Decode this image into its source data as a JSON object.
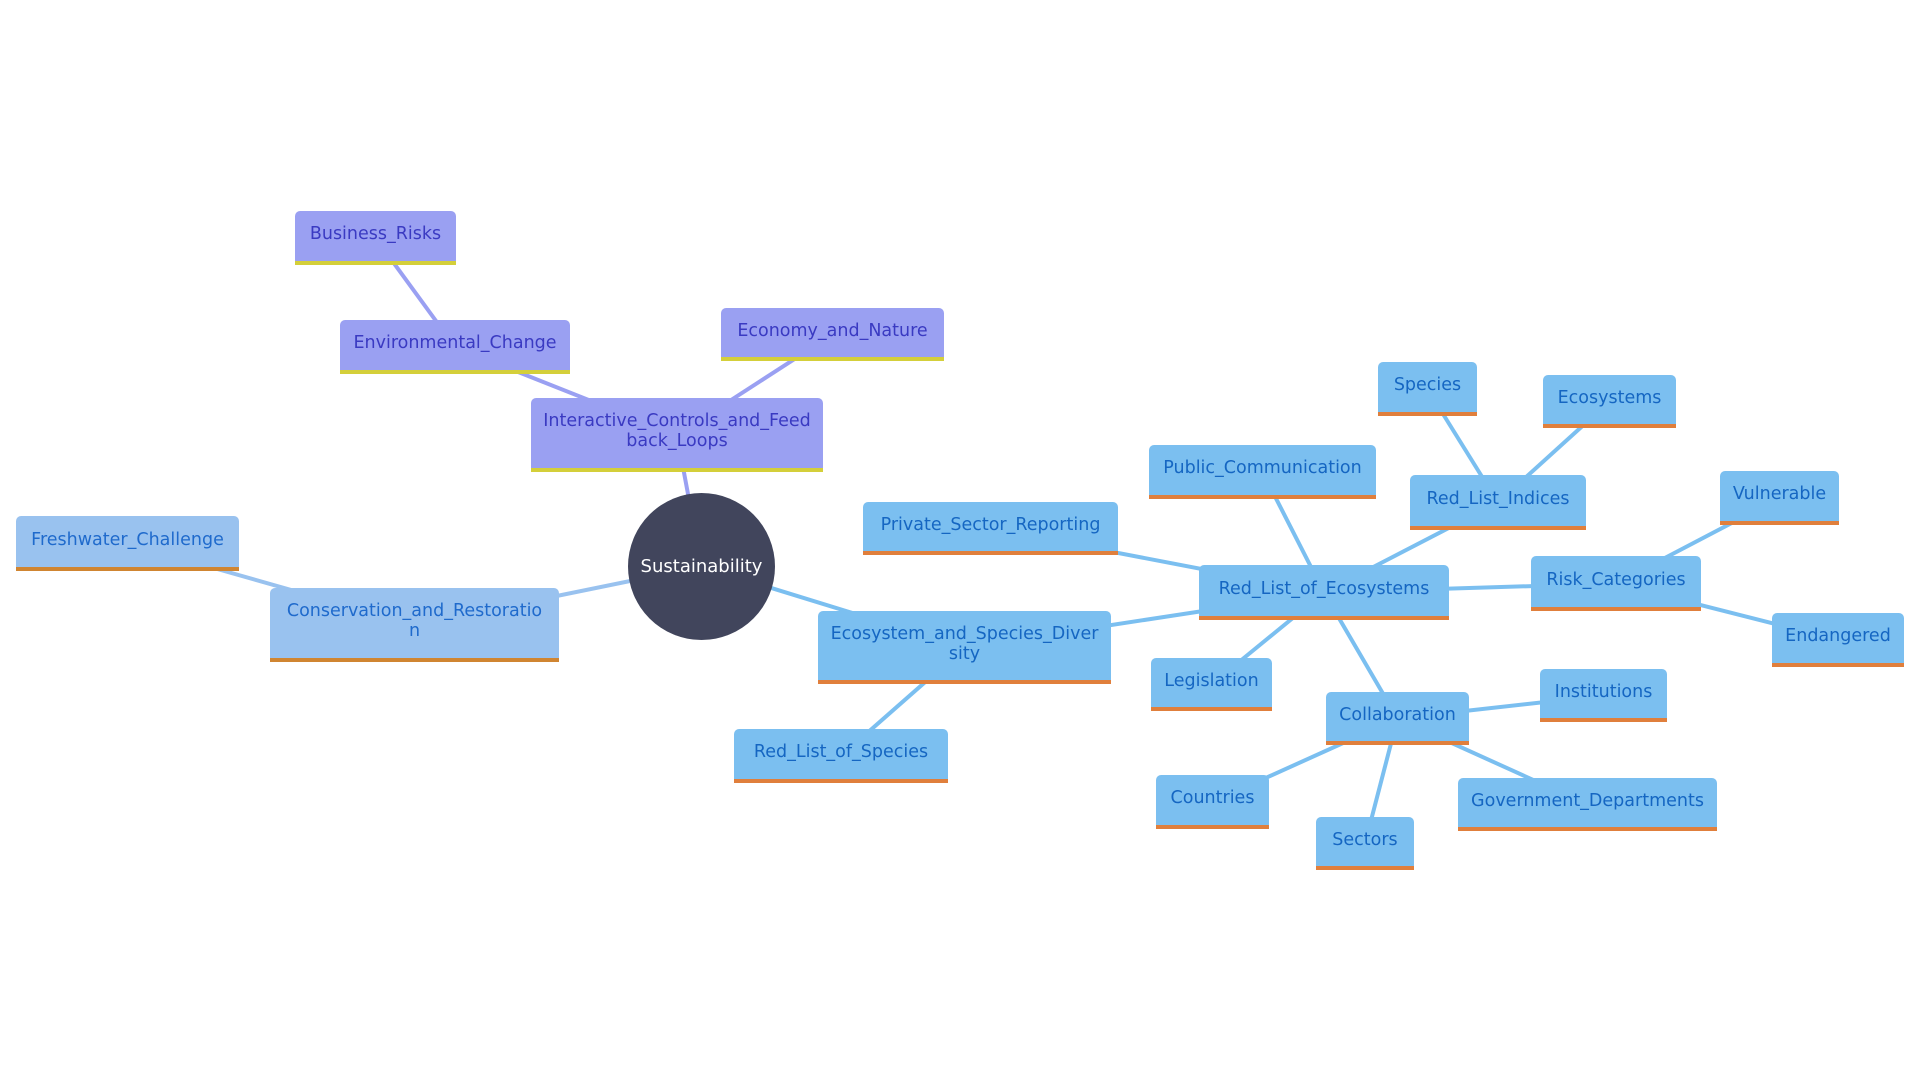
{
  "diagram": {
    "type": "mindmap",
    "colors": {
      "root_fill": "#41455c",
      "root_text": "#ffffff",
      "purple_fill": "#9aa0f2",
      "purple_text": "#3a3ac2",
      "purple_accent": "#d4cf3a",
      "purple_edge": "#9aa0f2",
      "blue_fill": "#7bbff0",
      "blue_text": "#1566c2",
      "blue_accent": "#e07f3c",
      "blue_edge": "#7bbff0",
      "lightblue_fill": "#99c2ef",
      "lightblue_text": "#1f6acc",
      "lightblue_accent": "#d08531",
      "lightblue_edge": "#99c2ef"
    },
    "root": {
      "id": "root",
      "label": "Sustainability"
    },
    "nodes": [
      {
        "id": "icfl",
        "label": "Interactive_Controls_and_Feedback_Loops",
        "parent": "root",
        "branch": "purple"
      },
      {
        "id": "envchange",
        "label": "Environmental_Change",
        "parent": "icfl",
        "branch": "purple"
      },
      {
        "id": "bizrisks",
        "label": "Business_Risks",
        "parent": "envchange",
        "branch": "purple"
      },
      {
        "id": "econature",
        "label": "Economy_and_Nature",
        "parent": "icfl",
        "branch": "purple"
      },
      {
        "id": "consrest",
        "label": "Conservation_and_Restoration",
        "parent": "root",
        "branch": "lightblue"
      },
      {
        "id": "freshwater",
        "label": "Freshwater_Challenge",
        "parent": "consrest",
        "branch": "lightblue"
      },
      {
        "id": "esd",
        "label": "Ecosystem_and_Species_Diversity",
        "parent": "root",
        "branch": "blue"
      },
      {
        "id": "rlspecies",
        "label": "Red_List_of_Species",
        "parent": "esd",
        "branch": "blue"
      },
      {
        "id": "rle",
        "label": "Red_List_of_Ecosystems",
        "parent": "esd",
        "branch": "blue"
      },
      {
        "id": "psr",
        "label": "Private_Sector_Reporting",
        "parent": "rle",
        "branch": "blue"
      },
      {
        "id": "pubcomm",
        "label": "Public_Communication",
        "parent": "rle",
        "branch": "blue"
      },
      {
        "id": "rli",
        "label": "Red_List_Indices",
        "parent": "rle",
        "branch": "blue"
      },
      {
        "id": "species",
        "label": "Species",
        "parent": "rli",
        "branch": "blue"
      },
      {
        "id": "ecosystems",
        "label": "Ecosystems",
        "parent": "rli",
        "branch": "blue"
      },
      {
        "id": "riskcat",
        "label": "Risk_Categories",
        "parent": "rle",
        "branch": "blue"
      },
      {
        "id": "vulnerable",
        "label": "Vulnerable",
        "parent": "riskcat",
        "branch": "blue"
      },
      {
        "id": "endangered",
        "label": "Endangered",
        "parent": "riskcat",
        "branch": "blue"
      },
      {
        "id": "legislation",
        "label": "Legislation",
        "parent": "rle",
        "branch": "blue"
      },
      {
        "id": "collab",
        "label": "Collaboration",
        "parent": "rle",
        "branch": "blue"
      },
      {
        "id": "institutions",
        "label": "Institutions",
        "parent": "collab",
        "branch": "blue"
      },
      {
        "id": "countries",
        "label": "Countries",
        "parent": "collab",
        "branch": "blue"
      },
      {
        "id": "sectors",
        "label": "Sectors",
        "parent": "collab",
        "branch": "blue"
      },
      {
        "id": "govdepts",
        "label": "Government_Departments",
        "parent": "collab",
        "branch": "blue"
      }
    ]
  }
}
